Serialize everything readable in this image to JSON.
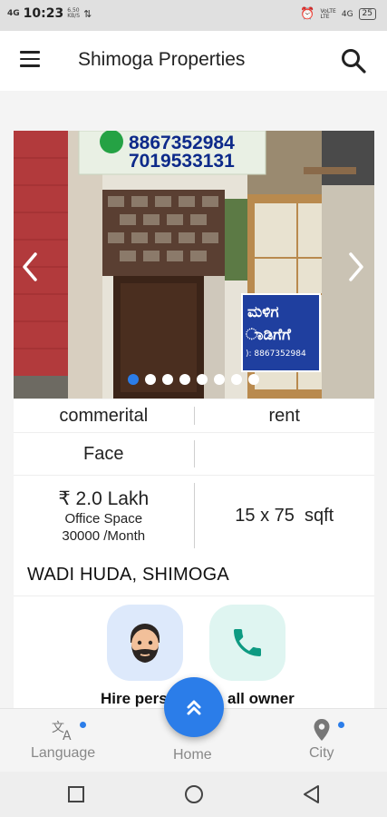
{
  "status_bar": {
    "signal": "4G",
    "time": "10:23",
    "speed_value": "6.50",
    "speed_unit": "KB/S",
    "network": "4G",
    "volte": "VoLTE",
    "battery": "25"
  },
  "app_bar": {
    "title": "Shimoga Properties"
  },
  "gallery": {
    "image_count": 8,
    "active_index": 0,
    "sign_phone_1": "8867352984",
    "sign_phone_2": "7019533131",
    "board_line_1": "ಮಳಿಗ",
    "board_line_2": "ಾಡಿಗೆಗೆ",
    "board_phone": "): 8867352984"
  },
  "details": {
    "category": "commerital",
    "listing_type": "rent",
    "facing_label": "Face",
    "facing_value": "",
    "price": "₹ 2.0 Lakh",
    "property_type": "Office Space",
    "monthly_rent": "30000 /Month",
    "size": "15 x 75  sqft"
  },
  "location": "WADI HUDA, SHIMOGA",
  "actions": {
    "hire_label": "Hire pers",
    "call_label": "all owner",
    "hire_icon": "man-avatar-icon",
    "call_icon": "phone-icon"
  },
  "bottom_nav": {
    "language": "Language",
    "home": "Home",
    "city": "City"
  },
  "colors": {
    "accent": "#2b7de9",
    "call_green": "#0e9a82",
    "hire_bg": "#dde9fb",
    "call_bg": "#dff5f1"
  }
}
